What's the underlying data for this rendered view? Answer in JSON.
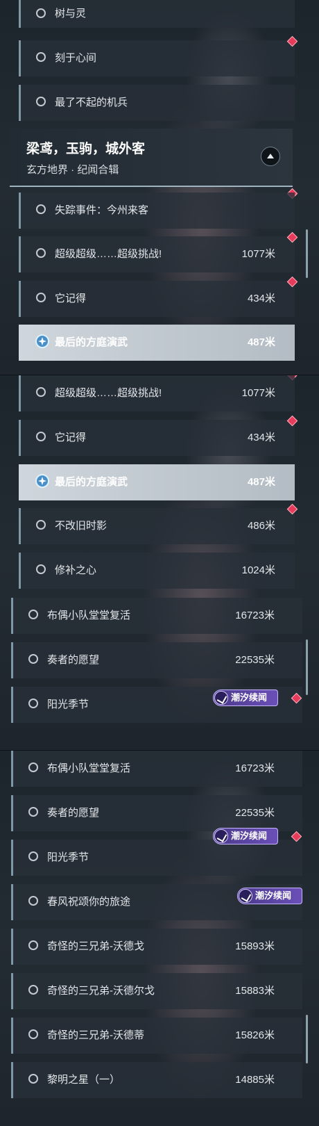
{
  "panel1": {
    "rows_top": [
      {
        "label": "树与灵",
        "distance": ""
      },
      {
        "label": "刻于心间",
        "distance": ""
      },
      {
        "label": "最了不起的机兵",
        "distance": ""
      }
    ],
    "header": {
      "title": "梁鸢，玉驹，城外客",
      "subtitle": "玄方地界 · 纪闻合辑"
    },
    "rows_bottom": [
      {
        "label": "失踪事件：今州来客",
        "distance": ""
      },
      {
        "label": "超级超级……超级挑战!",
        "distance": "1077米"
      },
      {
        "label": "它记得",
        "distance": "434米"
      },
      {
        "label": "最后的方庭演武",
        "distance": "487米"
      }
    ]
  },
  "panel2": {
    "rows": [
      {
        "label": "超级超级……超级挑战!",
        "distance": "1077米"
      },
      {
        "label": "它记得",
        "distance": "434米"
      },
      {
        "label": "最后的方庭演武",
        "distance": "487米"
      },
      {
        "label": "不改旧时影",
        "distance": "486米"
      },
      {
        "label": "修补之心",
        "distance": "1024米"
      },
      {
        "label": "布偶小队堂堂复活",
        "distance": "16723米"
      },
      {
        "label": "奏者的愿望",
        "distance": "22535米"
      },
      {
        "label": "阳光季节",
        "distance": ""
      }
    ],
    "badge": "潮汐续闻"
  },
  "panel3": {
    "rows": [
      {
        "label": "布偶小队堂堂复活",
        "distance": "16723米"
      },
      {
        "label": "奏者的愿望",
        "distance": "22535米"
      },
      {
        "label": "阳光季节",
        "distance": ""
      },
      {
        "label": "春风祝颂你的旅途",
        "distance": ""
      },
      {
        "label": "奇怪的三兄弟-沃德戈",
        "distance": "15893米"
      },
      {
        "label": "奇怪的三兄弟-沃德尔戈",
        "distance": "15883米"
      },
      {
        "label": "奇怪的三兄弟-沃德蒂",
        "distance": "15826米"
      },
      {
        "label": "黎明之星（一）",
        "distance": "14885米"
      }
    ],
    "badge": "潮汐续闻"
  },
  "colors": {
    "marker": "#e63b5a",
    "selected": "#c6cfd6",
    "badge": "#5a44a0"
  },
  "icons": {
    "row": "circle-icon",
    "tracking": "navigation-icon",
    "marker": "diamond-marker-icon",
    "collapse": "collapse-up-icon"
  }
}
